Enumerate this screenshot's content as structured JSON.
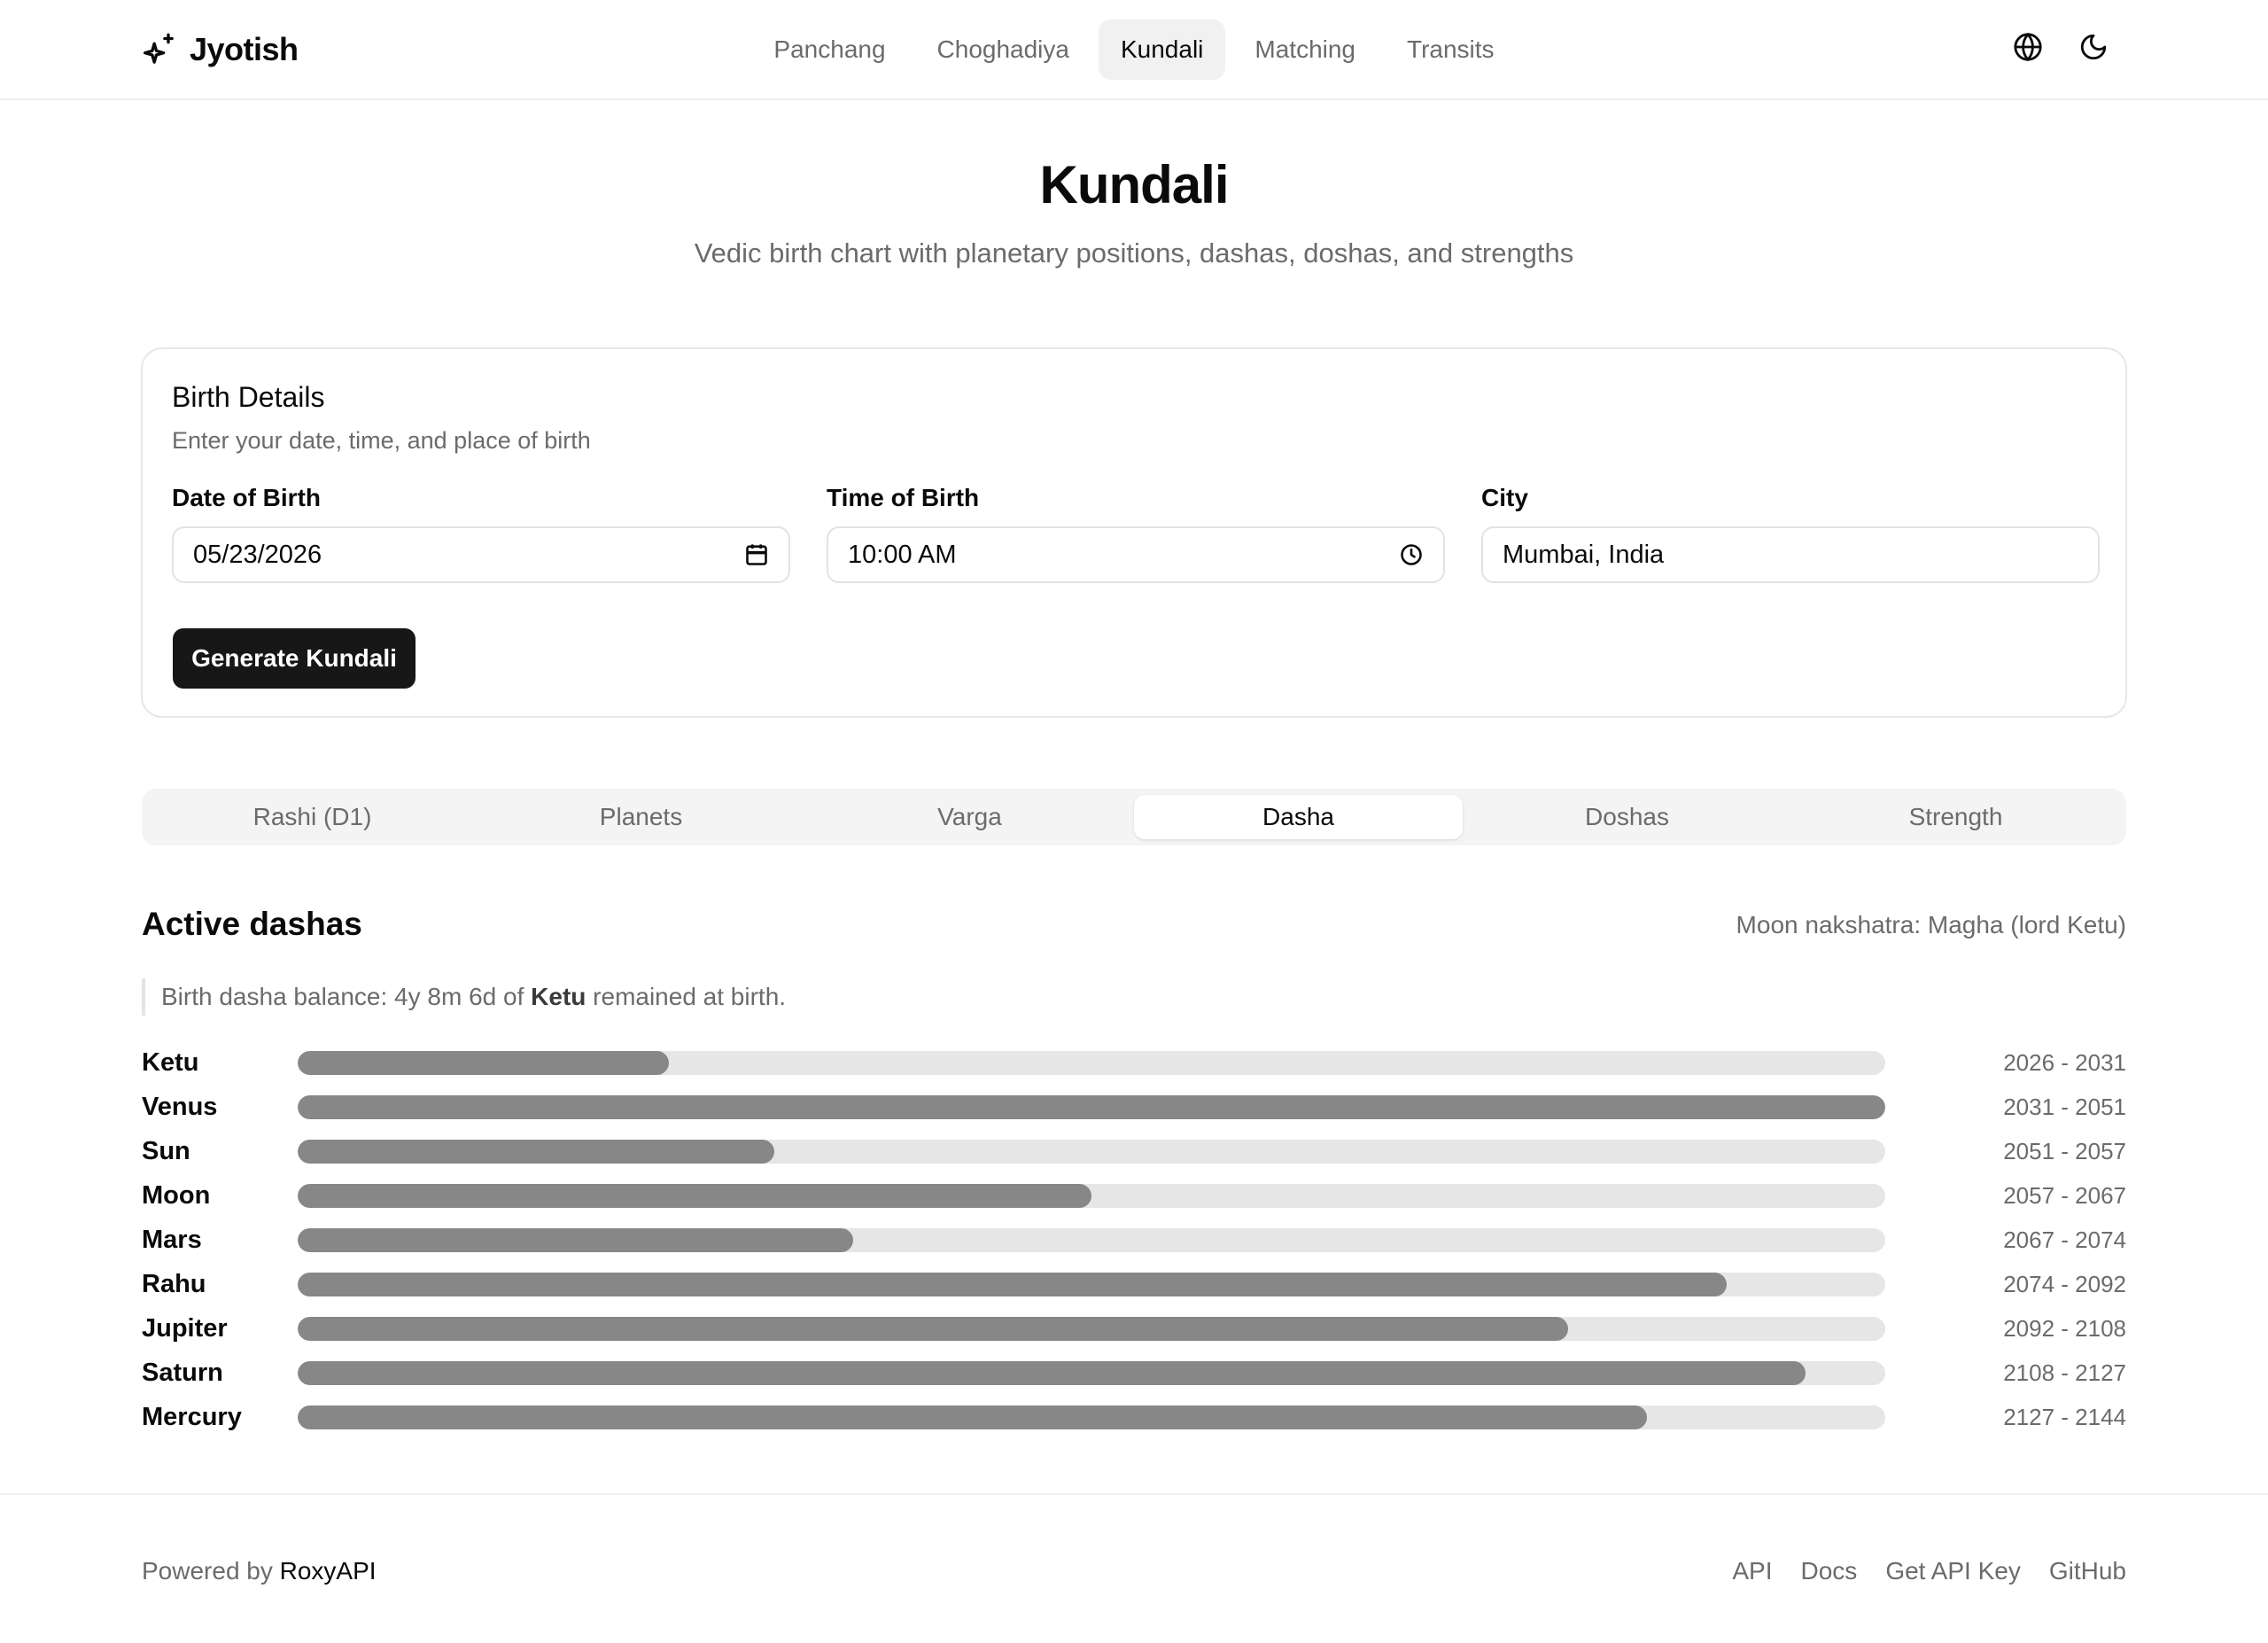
{
  "brand": {
    "name": "Jyotish"
  },
  "nav": [
    {
      "label": "Panchang",
      "active": false
    },
    {
      "label": "Choghadiya",
      "active": false
    },
    {
      "label": "Kundali",
      "active": true
    },
    {
      "label": "Matching",
      "active": false
    },
    {
      "label": "Transits",
      "active": false
    }
  ],
  "header_icons": [
    "globe-icon",
    "moon-icon"
  ],
  "page": {
    "title": "Kundali",
    "subtitle": "Vedic birth chart with planetary positions, dashas, doshas, and strengths"
  },
  "birth_form": {
    "title": "Birth Details",
    "description": "Enter your date, time, and place of birth",
    "date_label": "Date of Birth",
    "date_value": "05/23/2026",
    "time_label": "Time of Birth",
    "time_value": "10:00 AM",
    "city_label": "City",
    "city_value": "Mumbai, India",
    "submit_label": "Generate Kundali"
  },
  "tabs": [
    {
      "label": "Rashi (D1)",
      "active": false
    },
    {
      "label": "Planets",
      "active": false
    },
    {
      "label": "Varga",
      "active": false
    },
    {
      "label": "Dasha",
      "active": true
    },
    {
      "label": "Doshas",
      "active": false
    },
    {
      "label": "Strength",
      "active": false
    }
  ],
  "dasha": {
    "title": "Active dashas",
    "nakshatra": "Moon nakshatra: Magha (lord Ketu)",
    "balance_prefix": "Birth dasha balance: 4y 8m 6d of ",
    "balance_lord": "Ketu",
    "balance_suffix": " remained at birth.",
    "rows": [
      {
        "planet": "Ketu",
        "years": "2026 - 2031",
        "fraction": 0.234
      },
      {
        "planet": "Venus",
        "years": "2031 - 2051",
        "fraction": 1.0
      },
      {
        "planet": "Sun",
        "years": "2051 - 2057",
        "fraction": 0.3
      },
      {
        "planet": "Moon",
        "years": "2057 - 2067",
        "fraction": 0.5
      },
      {
        "planet": "Mars",
        "years": "2067 - 2074",
        "fraction": 0.35
      },
      {
        "planet": "Rahu",
        "years": "2074 - 2092",
        "fraction": 0.9
      },
      {
        "planet": "Jupiter",
        "years": "2092 - 2108",
        "fraction": 0.8
      },
      {
        "planet": "Saturn",
        "years": "2108 - 2127",
        "fraction": 0.95
      },
      {
        "planet": "Mercury",
        "years": "2127 - 2144",
        "fraction": 0.85
      }
    ]
  },
  "footer": {
    "powered_prefix": "Powered by ",
    "powered_brand": "RoxyAPI",
    "links": [
      "API",
      "Docs",
      "Get API Key",
      "GitHub"
    ]
  },
  "colors": {
    "primary_button": "#171717",
    "bar_fill": "#878787",
    "bar_track": "#e6e6e6",
    "muted_text": "#6b6b6b"
  }
}
